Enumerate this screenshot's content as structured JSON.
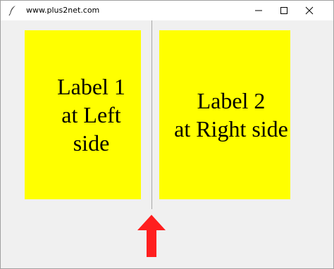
{
  "window": {
    "title": "www.plus2net.com",
    "controls": {
      "minimize_icon": "minimize-icon",
      "maximize_icon": "maximize-icon",
      "close_icon": "close-icon"
    }
  },
  "panes": [
    {
      "text": "Label 1\nat Left side",
      "background": "#ffff00"
    },
    {
      "text": "Label 2\nat Right side",
      "background": "#ffff00"
    }
  ],
  "annotation": {
    "arrow_icon": "up-arrow-icon",
    "arrow_color": "#ff1f1f"
  }
}
